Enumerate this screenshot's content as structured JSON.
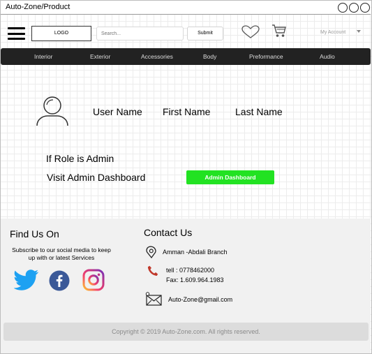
{
  "window": {
    "title": "Auto-Zone/Product"
  },
  "header": {
    "logo_label": "LOGO",
    "search_placeholder": "Search...",
    "submit_label": "Submit",
    "account_label": "My Account"
  },
  "nav": {
    "items": [
      "Interior",
      "Exterior",
      "Accessories",
      "Body",
      "Preformance",
      "Audio"
    ]
  },
  "profile": {
    "user_name": "User Name",
    "first_name": "First Name",
    "last_name": "Last Name"
  },
  "admin": {
    "condition": "If  Role is Admin",
    "visit_label": "Visit Admin Dashboard",
    "button_label": "Admin Dashboard",
    "button_color": "#22e222"
  },
  "footer": {
    "find_us_title": "Find Us On",
    "find_us_text": "Subscribe to our social media to keep up with or latest Services",
    "contact_title": "Contact Us",
    "address": "Amman -Abdali Branch",
    "phone": "tell : 0778462000",
    "fax": "Fax: 1.609.964.1983",
    "email": "Auto-Zone@gmail.com",
    "copyright": "Copyright © 2019 Auto-Zone.com. All rights reserved."
  },
  "icons": [
    "menu-icon",
    "heart-icon",
    "cart-icon",
    "user-avatar-icon",
    "twitter-icon",
    "facebook-icon",
    "instagram-icon",
    "location-icon",
    "phone-icon",
    "email-icon"
  ]
}
